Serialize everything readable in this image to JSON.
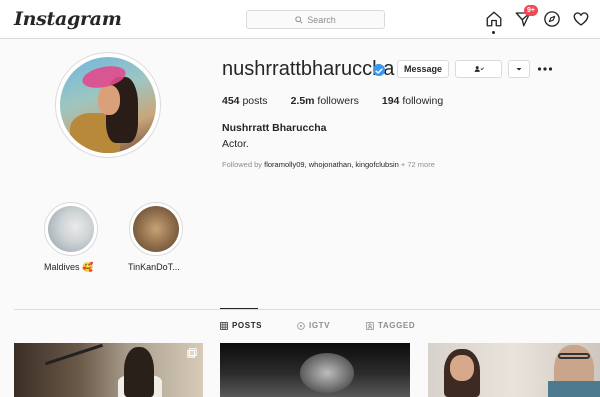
{
  "app": {
    "logo": "Instagram"
  },
  "search": {
    "placeholder": "Search"
  },
  "nav": {
    "notification_count": "9+"
  },
  "profile": {
    "username": "nushrrattbharuccha",
    "verified": true,
    "message_label": "Message",
    "posts_count": "454",
    "posts_label": "posts",
    "followers_count": "2.5m",
    "followers_label": "followers",
    "following_count": "194",
    "following_label": "following",
    "full_name": "Nushrratt Bharuccha",
    "bio": "Actor.",
    "followed_by_prefix": "Followed by",
    "followed_by_names": "floramolly09, whojonathan, kingofclubsin",
    "followed_by_more": "+ 72 more"
  },
  "highlights": [
    {
      "label": "Maldives 🥰"
    },
    {
      "label": "TinKanDoT..."
    }
  ],
  "tabs": [
    {
      "label": "POSTS",
      "active": true
    },
    {
      "label": "IGTV",
      "active": false
    },
    {
      "label": "TAGGED",
      "active": false
    }
  ],
  "colors": {
    "verified": "#3897f0",
    "badge": "#ed4956",
    "border": "#dbdbdb",
    "muted": "#8e8e8e"
  }
}
